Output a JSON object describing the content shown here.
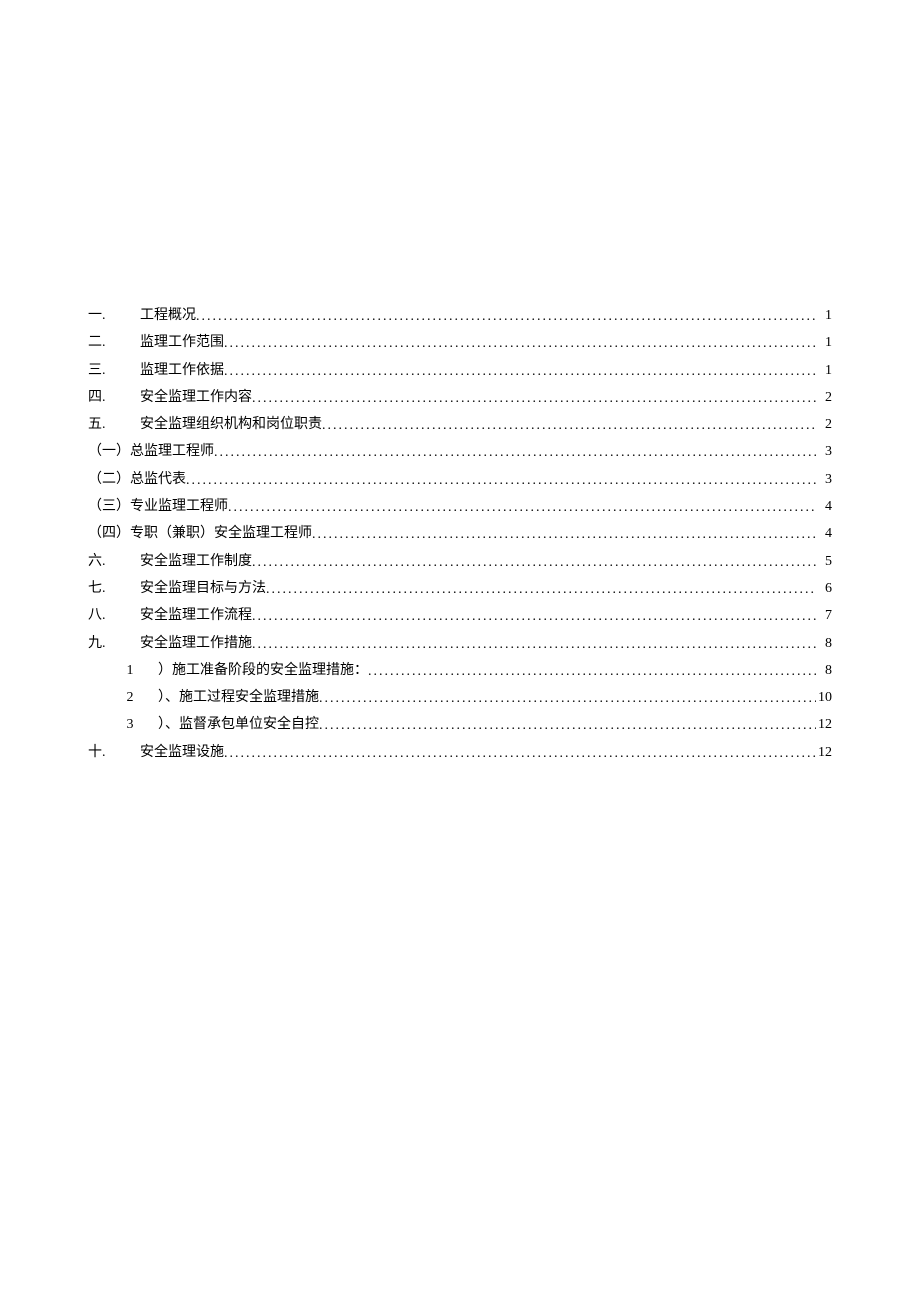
{
  "toc": {
    "entries": [
      {
        "num": "一.",
        "title": "工程概况",
        "page": "1",
        "level": 0,
        "numStyle": "main",
        "titlePad": true
      },
      {
        "num": "二.",
        "title": "监理工作范围",
        "page": "1",
        "level": 0,
        "numStyle": "main",
        "titlePad": true
      },
      {
        "num": "三.",
        "title": "监理工作依据",
        "page": "1",
        "level": 0,
        "numStyle": "main",
        "titlePad": true
      },
      {
        "num": "四.",
        "title": "安全监理工作内容",
        "page": "2",
        "level": 0,
        "numStyle": "main",
        "titlePad": true
      },
      {
        "num": "五.",
        "title": "安全监理组织机构和岗位职责",
        "page": "2",
        "level": 0,
        "numStyle": "main",
        "titlePad": true
      },
      {
        "num": "（一）",
        "title": "总监理工程师",
        "page": "3",
        "level": 0,
        "numStyle": "sub",
        "titlePad": false
      },
      {
        "num": "（二）",
        "title": "总监代表",
        "page": "3",
        "level": 0,
        "numStyle": "sub",
        "titlePad": false
      },
      {
        "num": "（三）",
        "title": "专业监理工程师",
        "page": "4",
        "level": 0,
        "numStyle": "sub",
        "titlePad": false
      },
      {
        "num": "（四）",
        "title": "专职（兼职）安全监理工程师",
        "page": "4",
        "level": 0,
        "numStyle": "sub",
        "titlePad": false
      },
      {
        "num": "六.",
        "title": "安全监理工作制度",
        "page": "5",
        "level": 0,
        "numStyle": "main",
        "titlePad": true
      },
      {
        "num": "七.",
        "title": "安全监理目标与方法",
        "page": "6",
        "level": 0,
        "numStyle": "main",
        "titlePad": true
      },
      {
        "num": "八.",
        "title": "安全监理工作流程",
        "page": "7",
        "level": 0,
        "numStyle": "main",
        "titlePad": true
      },
      {
        "num": "九.",
        "title": "安全监理工作措施",
        "page": "8",
        "level": 0,
        "numStyle": "main",
        "titlePad": true
      },
      {
        "num": "1",
        "title": "）施工准备阶段的安全监理措施：",
        "page": "8",
        "level": 1,
        "numStyle": "indent",
        "titlePad": false
      },
      {
        "num": "2",
        "title": "）、施工过程安全监理措施",
        "page": "10",
        "level": 1,
        "numStyle": "indent",
        "titlePad": false
      },
      {
        "num": "3",
        "title": "）、监督承包单位安全自控",
        "page": "12",
        "level": 1,
        "numStyle": "indent",
        "titlePad": false
      },
      {
        "num": "十.",
        "title": "安全监理设施",
        "page": "12",
        "level": 0,
        "numStyle": "main",
        "titlePad": true
      }
    ]
  }
}
